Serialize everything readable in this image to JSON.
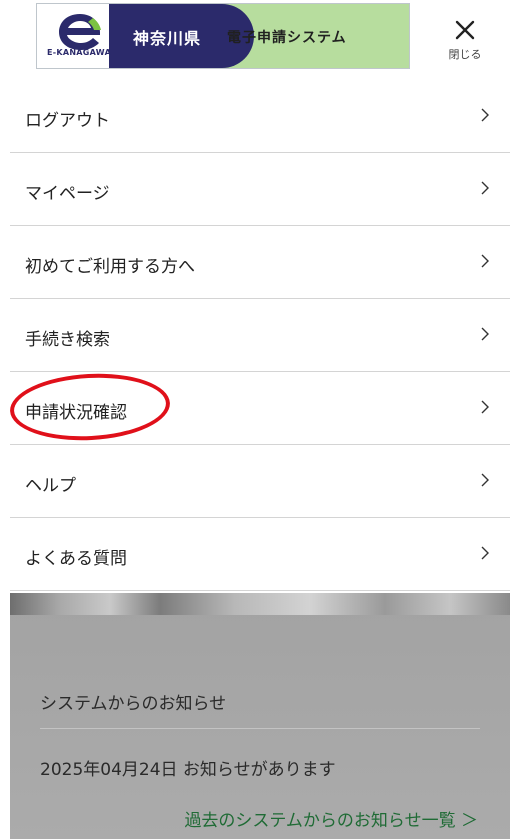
{
  "header": {
    "logo_mark_text": "E-KANAGAWA",
    "logo_prefecture": "神奈川県",
    "logo_system": "電子申請システム",
    "close_label": "閉じる"
  },
  "menu": {
    "items": [
      {
        "label": "ログアウト"
      },
      {
        "label": "マイページ"
      },
      {
        "label": "初めてご利用する方へ"
      },
      {
        "label": "手続き検索"
      },
      {
        "label": "申請状況確認"
      },
      {
        "label": "ヘルプ"
      },
      {
        "label": "よくある質問"
      }
    ]
  },
  "notice": {
    "title": "システムからのお知らせ",
    "text": "2025年04月24日 お知らせがあります",
    "link": "過去のシステムからのお知らせ一覧 ＞"
  },
  "colors": {
    "logo_navy": "#2b2a6b",
    "logo_green": "#b7dd9e",
    "highlight_red": "#e0101a",
    "link_green": "#1f6b35"
  }
}
